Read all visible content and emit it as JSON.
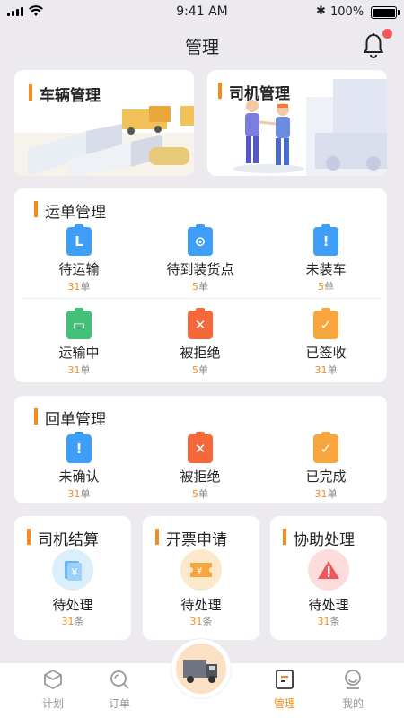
{
  "status": {
    "time": "9:41 AM",
    "battery": "100%"
  },
  "header": {
    "title": "管理"
  },
  "top_cards": [
    {
      "label": "车辆管理"
    },
    {
      "label": "司机管理"
    }
  ],
  "waybill": {
    "title": "运单管理",
    "items": [
      {
        "label": "待运输",
        "count": "31",
        "unit": "单",
        "icon": "clock-icon",
        "color": "#3f9ef7"
      },
      {
        "label": "待到装货点",
        "count": "5",
        "unit": "单",
        "icon": "location-icon",
        "color": "#3f9ef7"
      },
      {
        "label": "未装车",
        "count": "5",
        "unit": "单",
        "icon": "exclamation-icon",
        "color": "#3f9ef7"
      },
      {
        "label": "运输中",
        "count": "31",
        "unit": "单",
        "icon": "truck-icon",
        "color": "#43c07a"
      },
      {
        "label": "被拒绝",
        "count": "5",
        "unit": "单",
        "icon": "cross-icon",
        "color": "#f4683c"
      },
      {
        "label": "已签收",
        "count": "31",
        "unit": "单",
        "icon": "check-icon",
        "color": "#f7a53d"
      }
    ]
  },
  "receipt": {
    "title": "回单管理",
    "items": [
      {
        "label": "未确认",
        "count": "31",
        "unit": "单",
        "icon": "exclamation-icon",
        "color": "#3f9ef7"
      },
      {
        "label": "被拒绝",
        "count": "5",
        "unit": "单",
        "icon": "cross-icon",
        "color": "#f4683c"
      },
      {
        "label": "已完成",
        "count": "31",
        "unit": "单",
        "icon": "check-icon",
        "color": "#f7a53d"
      }
    ]
  },
  "mini_cards": [
    {
      "title": "司机结算",
      "label": "待处理",
      "count": "31",
      "unit": "条",
      "icon": "yen-doc-icon"
    },
    {
      "title": "开票申请",
      "label": "待处理",
      "count": "31",
      "unit": "条",
      "icon": "ticket-icon"
    },
    {
      "title": "协助处理",
      "label": "待处理",
      "count": "31",
      "unit": "条",
      "icon": "warning-icon"
    }
  ],
  "tabs": [
    {
      "label": "计划",
      "icon": "cube-icon"
    },
    {
      "label": "订单",
      "icon": "search-order-icon"
    },
    {
      "label": "管理",
      "icon": "manage-icon",
      "active": true
    },
    {
      "label": "我的",
      "icon": "profile-icon"
    }
  ],
  "colors": {
    "accent": "#f58a1f",
    "background": "#eceaee"
  }
}
